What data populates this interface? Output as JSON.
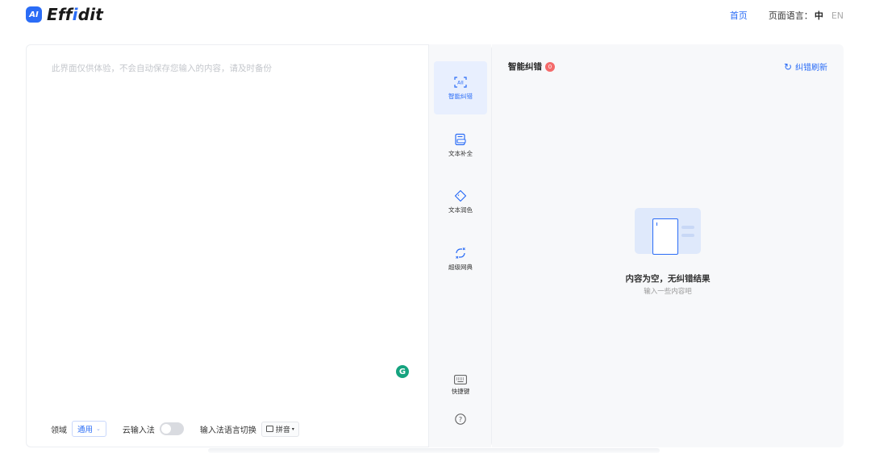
{
  "header": {
    "logo_mark": "AI",
    "logo_prefix": "Eff",
    "logo_i": "i",
    "logo_suffix": "dit",
    "nav_home": "首页",
    "page_language_label": "页面语言：",
    "lang_zh": "中",
    "lang_en": "EN"
  },
  "editor": {
    "placeholder": "此界面仅供体验，不会自动保存您输入的内容，请及时备份",
    "grammarly_letter": "G",
    "domain_label": "领域",
    "domain_value": "通用",
    "cloud_ime_label": "云输入法",
    "cloud_ime_enabled": false,
    "ime_switch_label": "输入法语言切换",
    "ime_button_label": "拼音"
  },
  "tools": {
    "items": [
      {
        "label": "智能纠错",
        "icon": "ai-scan-icon",
        "active": true
      },
      {
        "label": "文本补全",
        "icon": "document-list-icon",
        "active": false
      },
      {
        "label": "文本润色",
        "icon": "diamond-icon",
        "active": false
      },
      {
        "label": "超级网典",
        "icon": "transfer-icon",
        "active": false
      }
    ],
    "shortcut_label": "快捷键",
    "help_icon": "question-circle-icon"
  },
  "panel": {
    "title": "智能纠错",
    "count": "0",
    "refresh_label": "纠错刷新",
    "empty_title": "内容为空，无纠错结果",
    "empty_subtitle": "输入一些内容吧"
  },
  "colors": {
    "accent": "#2a6cf6",
    "badge": "#f46a6a",
    "panel_bg": "#f7f8fa"
  }
}
